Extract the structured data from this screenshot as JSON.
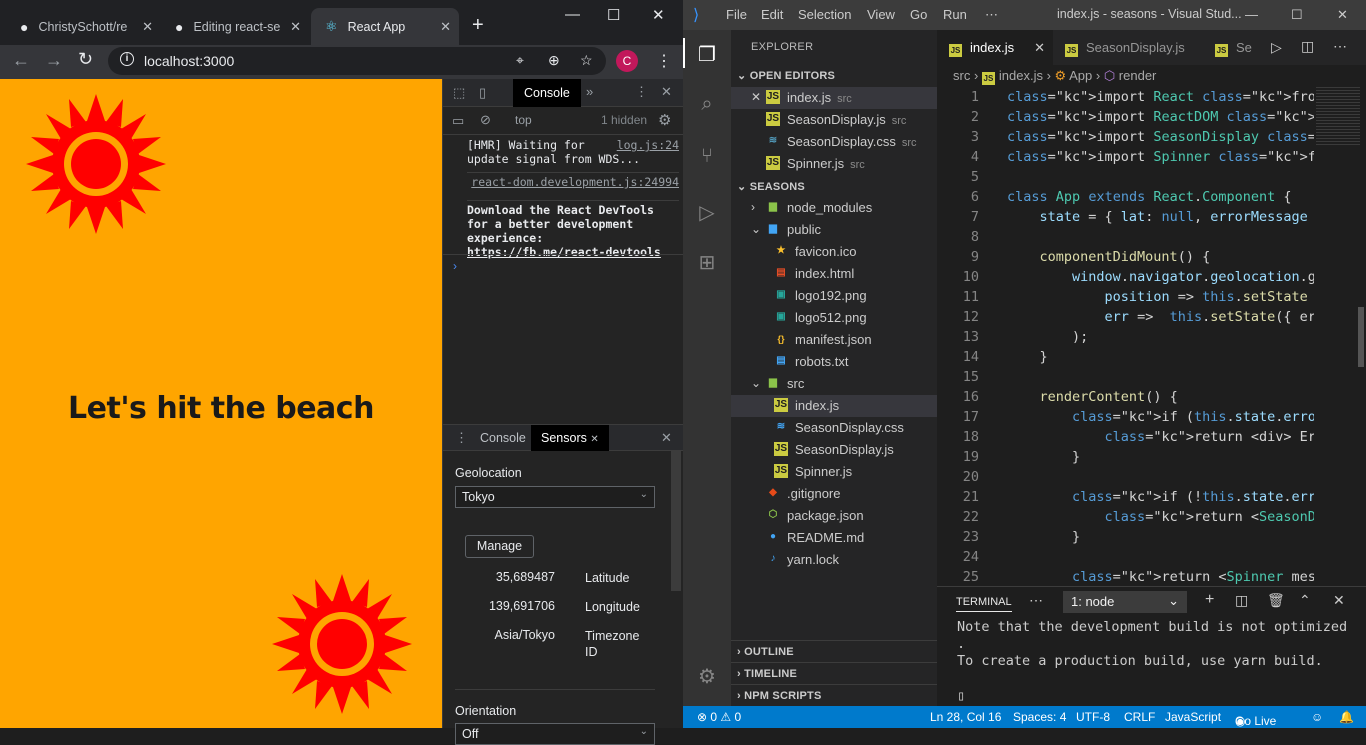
{
  "browser": {
    "tabs": [
      {
        "title": "ChristySchott/re",
        "icon": "github-icon"
      },
      {
        "title": "Editing react-se",
        "icon": "github-icon"
      },
      {
        "title": "React App",
        "icon": "react-icon"
      }
    ],
    "url": "localhost:3000",
    "avatar_letter": "C",
    "page": {
      "headline": "Let's hit the beach"
    },
    "colors": {
      "page_bg": "#ffa500",
      "sun": "#ff0000"
    }
  },
  "devtools": {
    "top_tab": "Console",
    "context": "top",
    "hidden_count": "1 hidden",
    "console": [
      {
        "text": "[HMR] Waiting for update signal from WDS...",
        "link": "log.js:24"
      },
      {
        "link": "react-dom.development.js:24994"
      },
      {
        "text": "Download the React DevTools for a better development experience: ",
        "link": "https://fb.me/react-devtools"
      }
    ],
    "drawer_tabs": [
      "Console",
      "Sensors"
    ],
    "sensors": {
      "geolocation_label": "Geolocation",
      "location": "Tokyo",
      "manage": "Manage",
      "rows": [
        {
          "value": "35,689487",
          "key": "Latitude"
        },
        {
          "value": "139,691706",
          "key": "Longitude"
        },
        {
          "value": "Asia/Tokyo",
          "key": "Timezone ID"
        }
      ],
      "orientation_label": "Orientation",
      "orientation": "Off"
    }
  },
  "vscode": {
    "menu": [
      "File",
      "Edit",
      "Selection",
      "View",
      "Go",
      "Run",
      "⋯"
    ],
    "window_title": "index.js - seasons - Visual Stud...",
    "explorer_title": "EXPLORER",
    "open_editors_title": "OPEN EDITORS",
    "open_editors": [
      {
        "name": "index.js",
        "path": "src"
      },
      {
        "name": "SeasonDisplay.js",
        "path": "src"
      },
      {
        "name": "SeasonDisplay.css",
        "path": "src"
      },
      {
        "name": "Spinner.js",
        "path": "src"
      }
    ],
    "project_title": "SEASONS",
    "tree": [
      {
        "name": "node_modules",
        "type": "folder"
      },
      {
        "name": "public",
        "type": "folder"
      },
      {
        "name": "favicon.ico",
        "type": "star"
      },
      {
        "name": "index.html",
        "type": "html"
      },
      {
        "name": "logo192.png",
        "type": "img"
      },
      {
        "name": "logo512.png",
        "type": "img"
      },
      {
        "name": "manifest.json",
        "type": "json"
      },
      {
        "name": "robots.txt",
        "type": "txt"
      },
      {
        "name": "src",
        "type": "folder"
      },
      {
        "name": "index.js",
        "type": "js"
      },
      {
        "name": "SeasonDisplay.css",
        "type": "css"
      },
      {
        "name": "SeasonDisplay.js",
        "type": "js"
      },
      {
        "name": "Spinner.js",
        "type": "js"
      },
      {
        "name": ".gitignore",
        "type": "git"
      },
      {
        "name": "package.json",
        "type": "npm"
      },
      {
        "name": "README.md",
        "type": "info"
      },
      {
        "name": "yarn.lock",
        "type": "yarn"
      }
    ],
    "bottom_sections": [
      "OUTLINE",
      "TIMELINE",
      "NPM SCRIPTS"
    ],
    "editor_tabs": [
      "index.js",
      "SeasonDisplay.js",
      "Se"
    ],
    "breadcrumb": [
      "src",
      "index.js",
      "App",
      "render"
    ],
    "code_lines": [
      "import React from 'react';",
      "import ReactDOM from 'react-dom';",
      "import SeasonDisplay from './SeasonDis",
      "import Spinner from './Spinner';",
      "",
      "class App extends React.Component {",
      "    state = { lat: null, errorMessage",
      "",
      "    componentDidMount() {",
      "        window.navigator.geolocation.g",
      "            position => this.setState",
      "            err =>  this.setState({ er",
      "        );",
      "    }",
      "",
      "    renderContent() {",
      "        if (this.state.errorMessage &&",
      "            return <div> Error: {this",
      "        }",
      "",
      "        if (!this.state.errorMessage &",
      "            return <SeasonDisplay lat=",
      "        }",
      "",
      "        return <Spinner message=\"Pleas"
    ],
    "terminal": {
      "tab": "TERMINAL",
      "selector": "1: node",
      "lines": [
        "Note that the development build is not optimized",
        ".",
        "To create a production build, use yarn build.",
        "▯"
      ]
    },
    "status": {
      "errors": "⊗ 0 ⚠ 0",
      "position": "Ln 28, Col 16",
      "spaces": "Spaces: 4",
      "encoding": "UTF-8",
      "eol": "CRLF",
      "language": "JavaScript",
      "golive": "Go Live"
    }
  }
}
